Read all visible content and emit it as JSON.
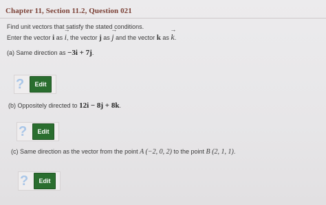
{
  "header": {
    "title": "Chapter 11, Section 11.2, Question 021"
  },
  "instructions": {
    "line1": "Find unit vectors that satisfy the stated conditions.",
    "line2_prefix": "Enter the vector",
    "i_bold": "i",
    "as": "as",
    "i_arrow": "i",
    "j_sep": ", the vector",
    "j_bold": "j",
    "j_arrow": "j",
    "k_sep": "and the vector",
    "k_bold": "k",
    "k_arrow": "k",
    "end": "."
  },
  "parts": [
    {
      "label": "(a) Same direction as",
      "expr": "−3i + 7j",
      "end": ".",
      "edit_label": "Edit",
      "qmark": "?"
    },
    {
      "label": "(b) Oppositely directed to",
      "expr": "12i − 8j + 8k",
      "end": ".",
      "edit_label": "Edit",
      "qmark": "?"
    },
    {
      "label": "(c) Same direction as the vector from the point",
      "pointA": "A (−2, 0, 2)",
      "mid": "to the point",
      "pointB": "B (2, 1, 1)",
      "end": ".",
      "edit_label": "Edit",
      "qmark": "?"
    }
  ]
}
